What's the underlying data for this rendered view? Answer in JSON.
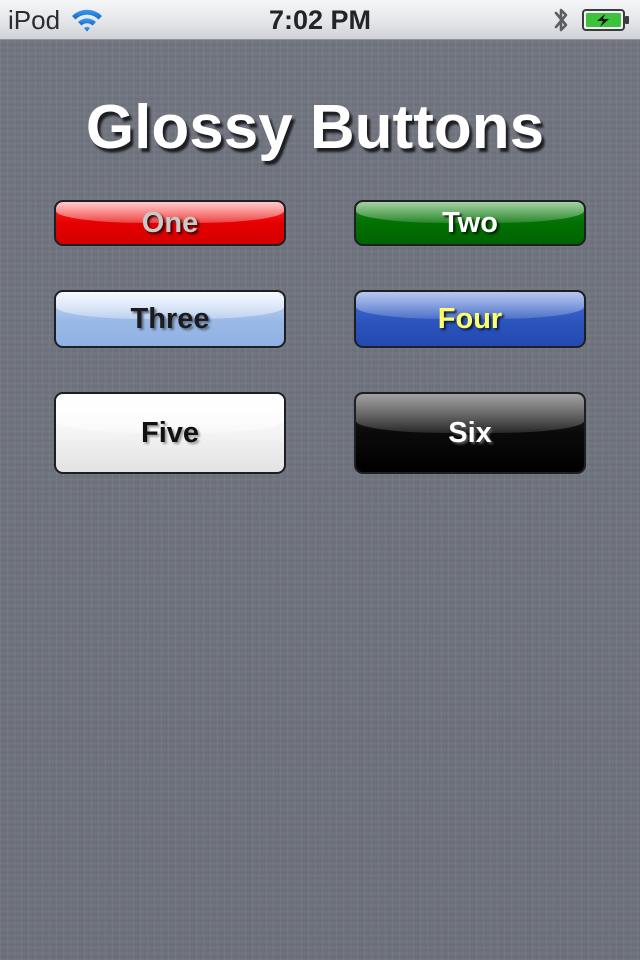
{
  "status_bar": {
    "carrier": "iPod",
    "time": "7:02 PM",
    "icons": {
      "wifi": "wifi-icon",
      "bluetooth": "bluetooth-icon",
      "battery": "battery-charging-icon"
    }
  },
  "page": {
    "title": "Glossy Buttons"
  },
  "buttons": [
    {
      "label": "One",
      "color": "#e60000",
      "text_color": "#c9c9c9"
    },
    {
      "label": "Two",
      "color": "#037003",
      "text_color": "#ffffff"
    },
    {
      "label": "Three",
      "color": "#9ab9e7",
      "text_color": "#1c1c1c"
    },
    {
      "label": "Four",
      "color": "#2b54bd",
      "text_color": "#ffff66"
    },
    {
      "label": "Five",
      "color": "#f4f4f4",
      "text_color": "#111111"
    },
    {
      "label": "Six",
      "color": "#000000",
      "text_color": "#ffffff"
    }
  ],
  "colors": {
    "background": "#6f7380",
    "battery_fill": "#3cc23c"
  }
}
